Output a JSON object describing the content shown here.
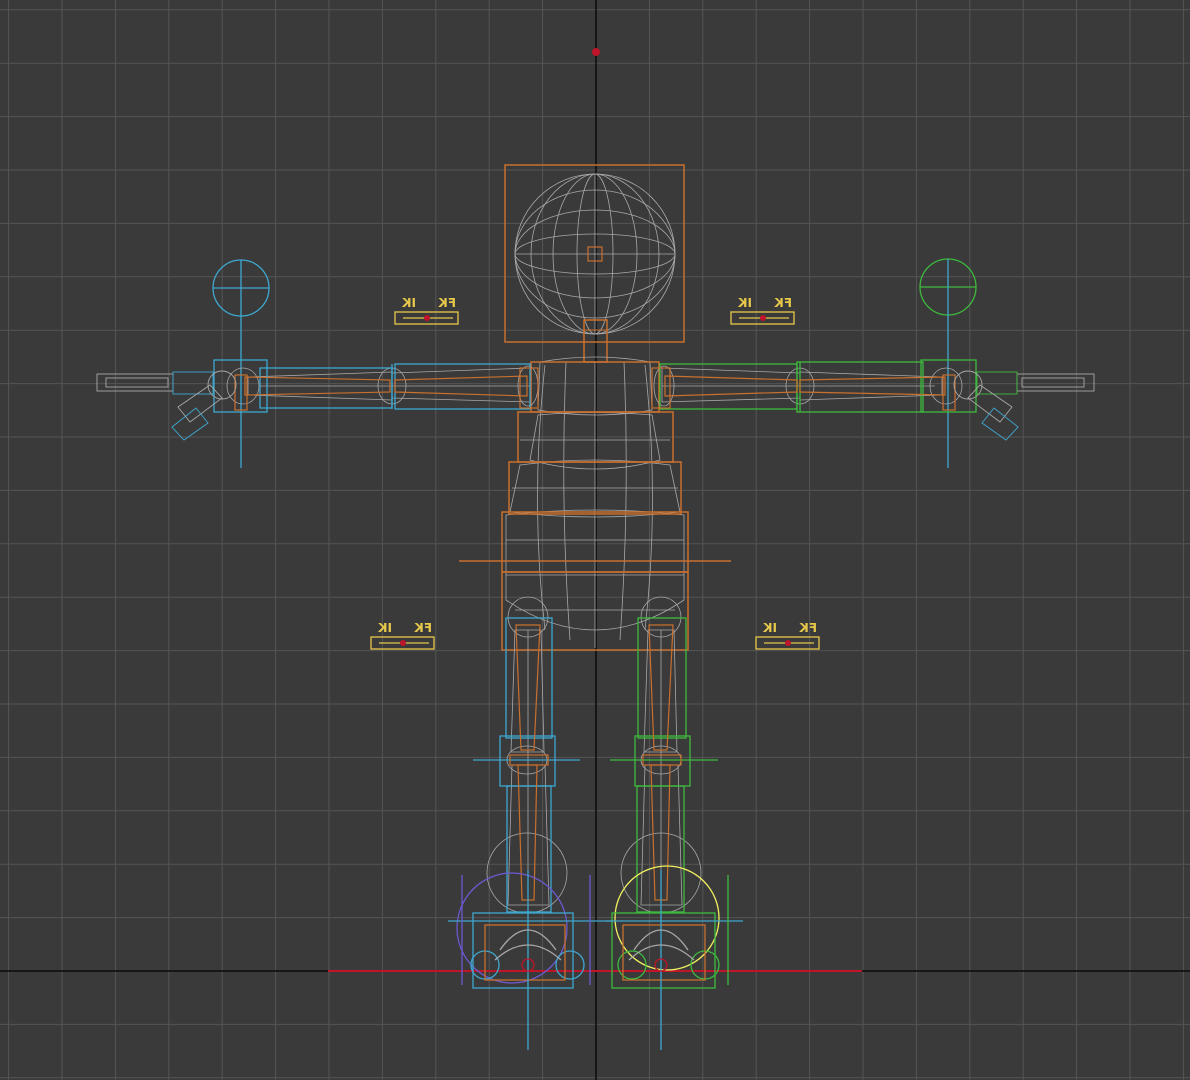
{
  "viewport": {
    "view": "front orthographic wireframe",
    "background_color": "#3a3a3a",
    "grid_color": "#555555",
    "axis_color": "#0a0a0a",
    "ground_line_color": "#c0142a"
  },
  "rig": {
    "character": "biped cartoon rig (T-pose)",
    "colors": {
      "spine": "#c8702e",
      "right_side": "#3fa8d0",
      "left_side": "#3dbb3d",
      "mesh": "#a8a8a8",
      "switch": "#e6c84a",
      "highlight": "#f0f060",
      "root": "#c0142a",
      "helper": "#6a5ad0"
    },
    "ik_fk_switches": [
      {
        "id": "arm-right",
        "fk_label": "FK",
        "ik_label": "IK"
      },
      {
        "id": "arm-left",
        "fk_label": "FK",
        "ik_label": "IK"
      },
      {
        "id": "leg-right",
        "fk_label": "FK",
        "ik_label": "IK"
      },
      {
        "id": "leg-left",
        "fk_label": "FK",
        "ik_label": "IK"
      }
    ]
  }
}
